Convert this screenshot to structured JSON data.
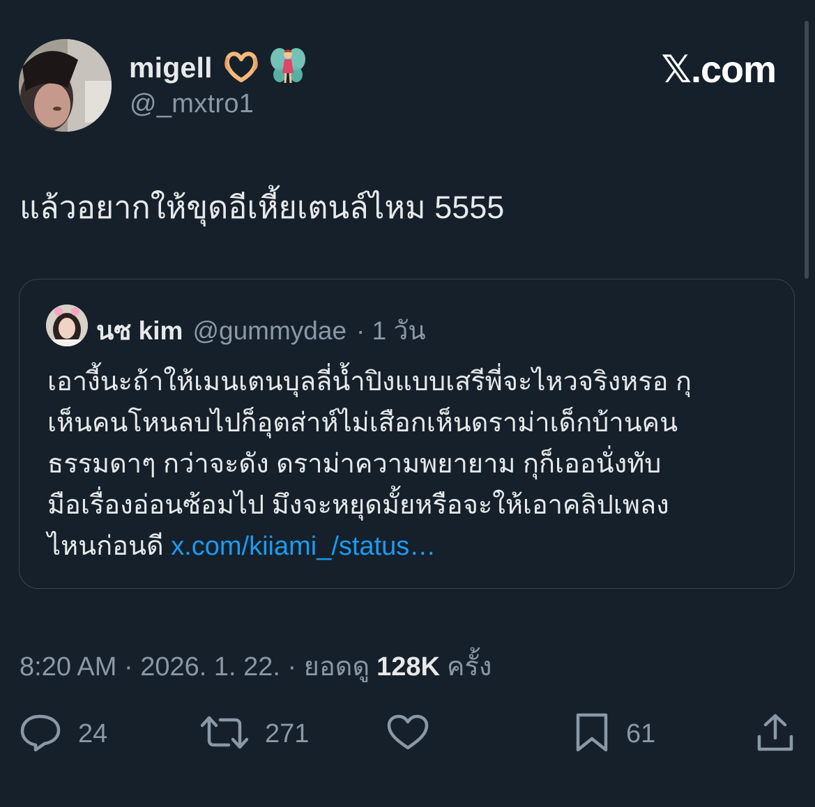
{
  "author": {
    "display_name": "migell",
    "emojis": [
      "heart-hands-emoji",
      "fairy-emoji"
    ],
    "handle": "@_mxtro1"
  },
  "brand": {
    "label": "𝕏.com"
  },
  "tweet": {
    "text": "แล้วอยากให้ขุดอีเหี้ยเตนล์ไหม 5555"
  },
  "quote": {
    "name": "นซ kim",
    "handle": "@gummydae",
    "time": "· 1 วัน",
    "lines": [
      "เอางี้นะถ้าให้เมนเตนบุลลี่น้ำปิงแบบเสรีพี่จะไหวจริงหรอ กุ",
      "เห็นคนโหนลบไปก็อุตส่าห์ไม่เสือกเห็นดราม่าเด็กบ้านคน",
      "ธรรมดาๆ กว่าจะดัง ดราม่าความพยายาม กุก็เออนั่งทับ",
      "มือเรื่องอ่อนซ้อมไป มึงจะหยุดมั้ยหรือจะให้เอาคลิปเพลง"
    ],
    "last_line_text": "ไหนก่อนดี ",
    "link": "x.com/kiiami_/status…"
  },
  "meta": {
    "time": "8:20 AM · 2026. 1. 22. · ยอดดู",
    "views": "128K",
    "views_suffix": "ครั้ง"
  },
  "actions": {
    "replies": "24",
    "retweets": "271",
    "bookmarks": "61"
  },
  "colors": {
    "background": "#15202b",
    "text": "#e7e9ea",
    "muted": "#8b98a5",
    "link": "#1d9bf0",
    "border": "#38444d"
  }
}
